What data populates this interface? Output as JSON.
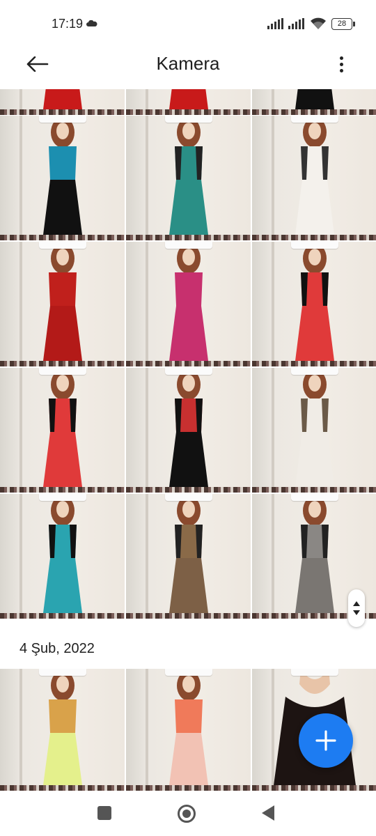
{
  "status_bar": {
    "time": "17:19",
    "battery": "28",
    "icons": [
      "cloud-icon",
      "signal-icon",
      "signal-icon",
      "wifi-icon",
      "battery-icon"
    ]
  },
  "app_bar": {
    "title": "Kamera",
    "back_icon": "arrow-left-icon",
    "menu_icon": "more-vertical-icon"
  },
  "sections": [
    {
      "date": "",
      "photos": [
        {
          "dress": "red"
        },
        {
          "dress": "red"
        },
        {
          "dress": "black"
        },
        {
          "dress": "teal-sequin-jacket"
        },
        {
          "dress": "teal-mermaid-lace"
        },
        {
          "dress": "white-lace"
        },
        {
          "dress": "red-sequin"
        },
        {
          "dress": "magenta"
        },
        {
          "dress": "red-black-panel"
        },
        {
          "dress": "red-black-panel"
        },
        {
          "dress": "black-red-panel"
        },
        {
          "dress": "white-leopard"
        },
        {
          "dress": "turquoise-black-panel"
        },
        {
          "dress": "leopard"
        },
        {
          "dress": "grey-leopard"
        }
      ]
    },
    {
      "date": "4 Şub, 2022",
      "photos": [
        {
          "dress": "yellow-leopard-top"
        },
        {
          "dress": "coral-ombre"
        },
        {
          "dress": "black-closeup"
        }
      ]
    }
  ],
  "fab_icon": "plus-icon",
  "scroll_handle_icon": "fast-scroll-icon",
  "nav": [
    "recents-icon",
    "home-icon",
    "back-icon"
  ]
}
